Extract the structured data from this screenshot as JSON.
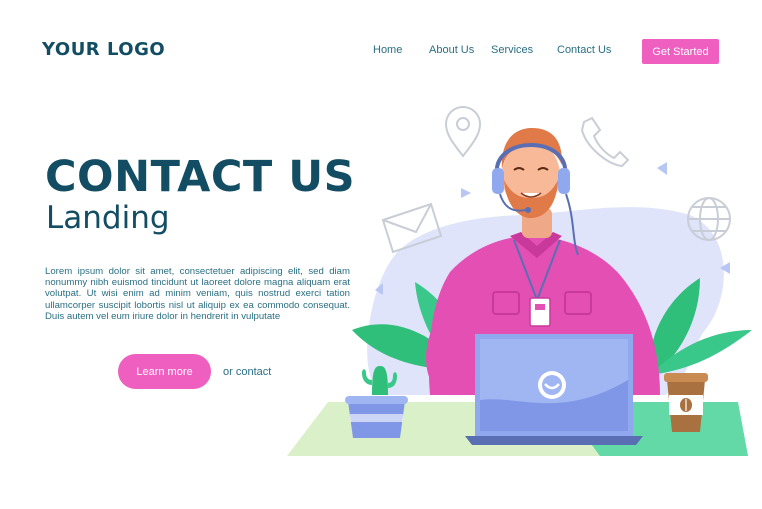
{
  "header": {
    "logo": "YOUR LOGO",
    "nav": [
      "Home",
      "About Us",
      "Services",
      "Contact Us"
    ],
    "cta_label": "Get Started"
  },
  "hero": {
    "title": "CONTACT US",
    "subtitle": "Landing",
    "body": "Lorem ipsum dolor sit amet, consectetuer adipiscing elit, sed diam nonummy nibh euismod tincidunt ut laoreet dolore magna aliquam erat volutpat. Ut wisi enim ad minim veniam, quis nostrud exerci tation ullamcorper suscipit lobortis nisl ut aliquip ex ea commodo consequat. Duis autem vel eum iriure dolor in hendrerit in vulputate",
    "learn_more_label": "Learn more",
    "contact_link": "or contact"
  },
  "illustration": {
    "subject": "customer-support-agent-with-headset-and-laptop",
    "icons": [
      "location-pin-icon",
      "phone-icon",
      "mail-icon",
      "globe-icon"
    ]
  },
  "colors": {
    "primary_text": "#124d63",
    "accent_pink": "#ee5fbf",
    "nav_text": "#2a6f83",
    "shirt": "#e44fb4",
    "laptop": "#8fa8ee",
    "blob": "#dfe4fb",
    "leaf": "#2fbf7a"
  }
}
